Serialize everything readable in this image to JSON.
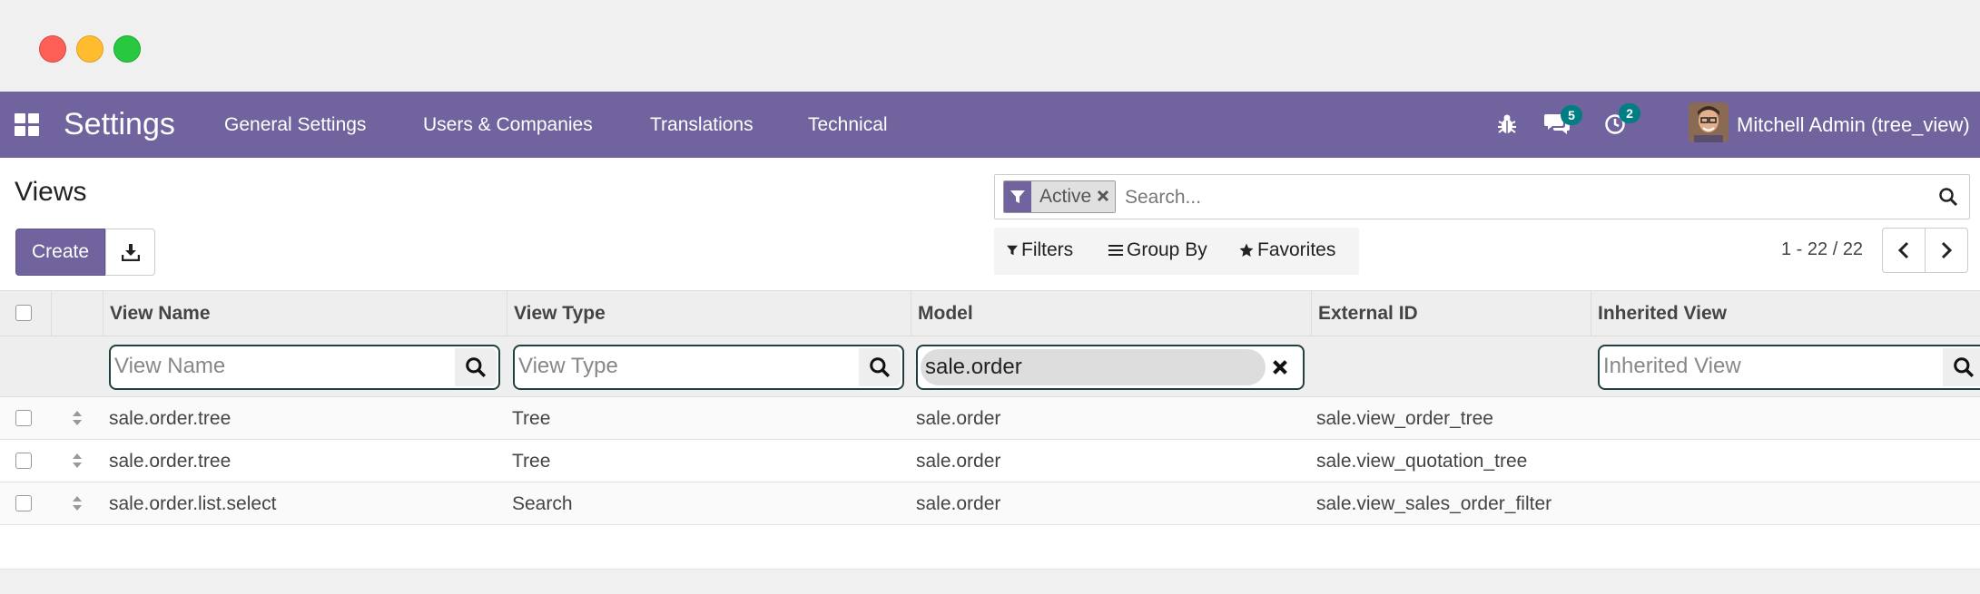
{
  "navbar": {
    "app_name": "Settings",
    "menu": [
      "General Settings",
      "Users & Companies",
      "Translations",
      "Technical"
    ],
    "messages_count": "5",
    "activities_count": "2",
    "user": "Mitchell Admin (tree_view)"
  },
  "control": {
    "breadcrumb": "Views",
    "create_label": "Create",
    "facet_label": "Active",
    "search_placeholder": "Search...",
    "filters_label": "Filters",
    "groupby_label": "Group By",
    "favorites_label": "Favorites",
    "pager": "1 - 22 / 22"
  },
  "table": {
    "columns": [
      "View Name",
      "View Type",
      "Model",
      "External ID",
      "Inherited View"
    ],
    "filters": {
      "view_name_placeholder": "View Name",
      "view_type_placeholder": "View Type",
      "model_value": "sale.order",
      "inherited_placeholder": "Inherited View"
    },
    "rows": [
      {
        "name": "sale.order.tree",
        "type": "Tree",
        "model": "sale.order",
        "external_id": "sale.view_order_tree",
        "inherited": ""
      },
      {
        "name": "sale.order.tree",
        "type": "Tree",
        "model": "sale.order",
        "external_id": "sale.view_quotation_tree",
        "inherited": ""
      },
      {
        "name": "sale.order.list.select",
        "type": "Search",
        "model": "sale.order",
        "external_id": "sale.view_sales_order_filter",
        "inherited": ""
      }
    ]
  },
  "colors": {
    "brand": "#71639e",
    "badge": "#017e84"
  }
}
